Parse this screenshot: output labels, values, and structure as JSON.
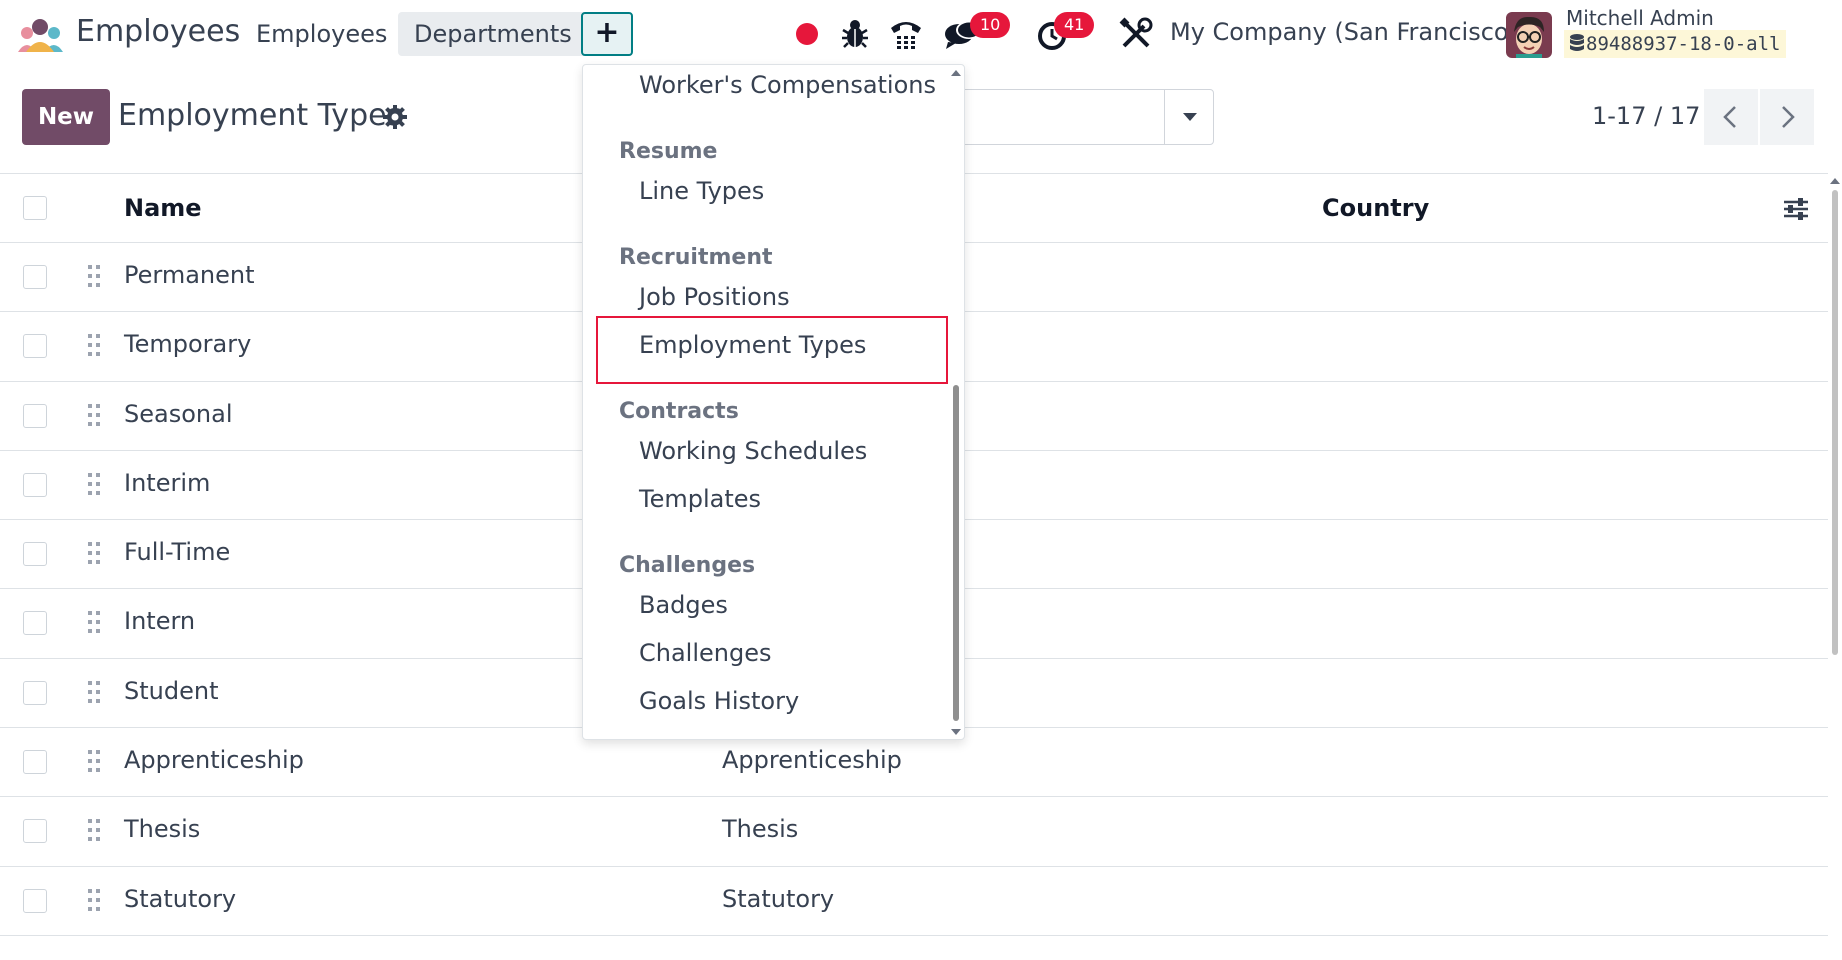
{
  "navbar": {
    "app_name": "Employees",
    "menu": [
      {
        "label": "Employees"
      },
      {
        "label": "Departments"
      }
    ],
    "plus_label": "+",
    "chat_count": "10",
    "activity_count": "41",
    "company": "My Company (San Francisco)",
    "user_name": "Mitchell Admin",
    "database": "89488937-18-0-all"
  },
  "control_panel": {
    "new_label": "New",
    "title": "Employment Types",
    "pager": "1-17 / 17"
  },
  "table": {
    "headers": {
      "name": "Name",
      "country": "Country"
    },
    "rows": [
      {
        "name": "Permanent",
        "code": ""
      },
      {
        "name": "Temporary",
        "code": ""
      },
      {
        "name": "Seasonal",
        "code": ""
      },
      {
        "name": "Interim",
        "code": ""
      },
      {
        "name": "Full-Time",
        "code": ""
      },
      {
        "name": "Intern",
        "code": ""
      },
      {
        "name": "Student",
        "code": ""
      },
      {
        "name": "Apprenticeship",
        "code": "Apprenticeship"
      },
      {
        "name": "Thesis",
        "code": "Thesis"
      },
      {
        "name": "Statutory",
        "code": "Statutory"
      }
    ]
  },
  "dropdown": {
    "sections": [
      {
        "header": "",
        "items": [
          "Worker's Compensations"
        ]
      },
      {
        "header": "Resume",
        "items": [
          "Line Types"
        ]
      },
      {
        "header": "Recruitment",
        "items": [
          "Job Positions",
          "Employment Types"
        ]
      },
      {
        "header": "Contracts",
        "items": [
          "Working Schedules",
          "Templates"
        ]
      },
      {
        "header": "Challenges",
        "items": [
          "Badges",
          "Challenges",
          "Goals History"
        ]
      }
    ],
    "highlighted_item": "Employment Types"
  },
  "colors": {
    "brand": "#714b67",
    "accent": "#017e84",
    "badge": "#e6173b",
    "highlight_box": "#e6173b"
  },
  "icons": [
    "app-logo-icon",
    "recording-dot-icon",
    "bug-icon",
    "phone-icon",
    "chat-icon",
    "clock-icon",
    "tools-icon",
    "database-icon",
    "gear-icon",
    "caret-down-icon",
    "chevron-left-icon",
    "chevron-right-icon",
    "optional-columns-icon",
    "drag-handle-icon"
  ]
}
